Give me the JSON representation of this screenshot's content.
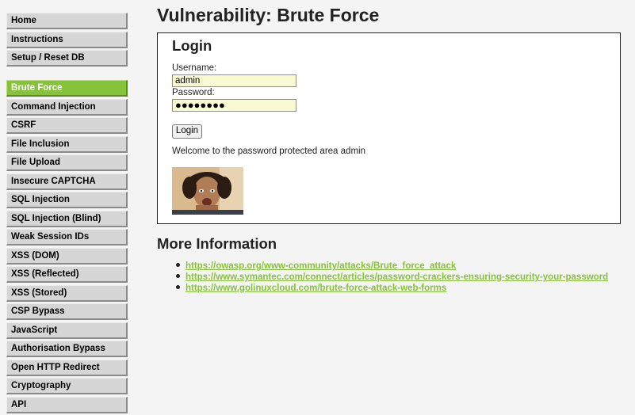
{
  "sidebar": {
    "group1": [
      "Home",
      "Instructions",
      "Setup / Reset DB"
    ],
    "group2": [
      "Brute Force",
      "Command Injection",
      "CSRF",
      "File Inclusion",
      "File Upload",
      "Insecure CAPTCHA",
      "SQL Injection",
      "SQL Injection (Blind)",
      "Weak Session IDs",
      "XSS (DOM)",
      "XSS (Reflected)",
      "XSS (Stored)",
      "CSP Bypass",
      "JavaScript",
      "Authorisation Bypass",
      "Open HTTP Redirect",
      "Cryptography",
      "API"
    ],
    "selected": "Brute Force"
  },
  "main": {
    "title": "Vulnerability: Brute Force",
    "login": {
      "heading": "Login",
      "username_label": "Username:",
      "username_value": "admin",
      "password_label": "Password:",
      "password_value": "●●●●●●●●",
      "button_label": "Login",
      "welcome_text": "Welcome to the password protected area admin"
    },
    "more_info": {
      "heading": "More Information",
      "links": [
        "https://owasp.org/www-community/attacks/Brute_force_attack",
        "https://www.symantec.com/connect/articles/password-crackers-ensuring-security-your-password",
        "https://www.golinuxcloud.com/brute-force-attack-web-forms"
      ]
    }
  },
  "colors": {
    "accent": "#86c23a",
    "menu_bg": "#d6d6d6",
    "input_bg": "#fafad2"
  }
}
